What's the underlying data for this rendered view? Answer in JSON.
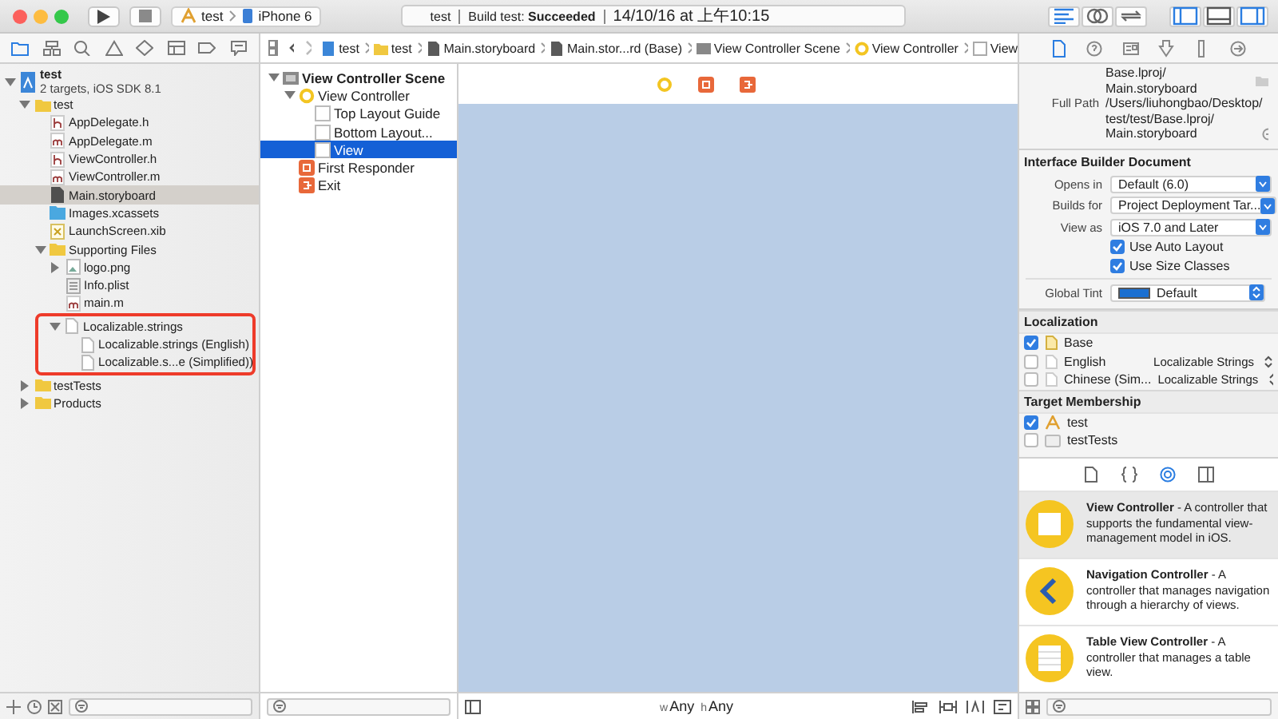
{
  "toolbar": {
    "scheme": "test",
    "device": "iPhone 6",
    "status": {
      "project": "test",
      "build": "Build test: **Succeeded**",
      "time": "14/10/16 at 上午10:15"
    },
    "editor_buttons": [
      {
        "kind": "standard",
        "selected": true
      },
      {
        "kind": "assistant",
        "selected": false
      },
      {
        "kind": "version",
        "selected": false
      }
    ],
    "view_buttons": [
      {
        "kind": "left",
        "selected": true
      },
      {
        "kind": "bottom",
        "selected": false
      },
      {
        "kind": "right",
        "selected": true
      }
    ]
  },
  "navigator_tabs": [
    {
      "kind": "folder",
      "selected": true
    },
    {
      "kind": "hierarchy",
      "selected": false
    },
    {
      "kind": "search",
      "selected": false
    },
    {
      "kind": "warning",
      "selected": false
    },
    {
      "kind": "test",
      "selected": false
    },
    {
      "kind": "debug",
      "selected": false
    },
    {
      "kind": "breakpoint",
      "selected": false
    },
    {
      "kind": "log",
      "selected": false
    }
  ],
  "navigator": [
    {
      "label": "test",
      "subtitle": "2 targets, iOS SDK 8.1",
      "kind": "project",
      "expanded": true,
      "selected": false,
      "highlighted": false,
      "children": [
        {
          "label": "test",
          "kind": "folder",
          "expanded": true,
          "selected": false,
          "highlighted": false,
          "children": [
            {
              "label": "AppDelegate.h",
              "kind": "h",
              "selected": false,
              "highlighted": false
            },
            {
              "label": "AppDelegate.m",
              "kind": "m",
              "selected": false,
              "highlighted": false
            },
            {
              "label": "ViewController.h",
              "kind": "h",
              "selected": false,
              "highlighted": false
            },
            {
              "label": "ViewController.m",
              "kind": "m",
              "selected": false,
              "highlighted": false
            },
            {
              "label": "Main.storyboard",
              "kind": "storyboard",
              "selected": true,
              "highlighted": false
            },
            {
              "label": "Images.xcassets",
              "kind": "assets",
              "selected": false,
              "highlighted": false
            },
            {
              "label": "LaunchScreen.xib",
              "kind": "xib",
              "selected": false,
              "highlighted": false
            },
            {
              "label": "Supporting Files",
              "kind": "folder",
              "expanded": true,
              "selected": false,
              "highlighted": false,
              "children": [
                {
                  "label": "logo.png",
                  "kind": "png",
                  "expanded": false,
                  "selected": false,
                  "highlighted": false
                },
                {
                  "label": "Info.plist",
                  "kind": "plist",
                  "selected": false,
                  "highlighted": false
                },
                {
                  "label": "main.m",
                  "kind": "m",
                  "selected": false,
                  "highlighted": false
                },
                {
                  "label": "Localizable.strings",
                  "kind": "strings",
                  "expanded": true,
                  "selected": false,
                  "highlighted": true,
                  "children": [
                    {
                      "label": "Localizable.strings (English)",
                      "kind": "strings",
                      "selected": false
                    },
                    {
                      "label": "Localizable.s...e (Simplified))",
                      "kind": "strings",
                      "selected": false
                    }
                  ]
                }
              ]
            }
          ]
        },
        {
          "label": "testTests",
          "kind": "folder",
          "expanded": false,
          "selected": false,
          "highlighted": false
        },
        {
          "label": "Products",
          "kind": "folder",
          "expanded": false,
          "selected": false,
          "highlighted": false
        }
      ]
    }
  ],
  "jump_bar": [
    {
      "label": "test",
      "kind": "project"
    },
    {
      "label": "test",
      "kind": "folder"
    },
    {
      "label": "Main.storyboard",
      "kind": "storyboard"
    },
    {
      "label": "Main.stor...rd (Base)",
      "kind": "storyboard"
    },
    {
      "label": "View Controller Scene",
      "kind": "scene"
    },
    {
      "label": "View Controller",
      "kind": "controller"
    },
    {
      "label": "View",
      "kind": "view"
    }
  ],
  "outline": [
    {
      "label": "View Controller Scene",
      "kind": "scene",
      "expanded": true,
      "selected": false,
      "children": [
        {
          "label": "View Controller",
          "kind": "controller",
          "expanded": true,
          "selected": false,
          "children": [
            {
              "label": "Top Layout Guide",
              "kind": "view",
              "selected": false
            },
            {
              "label": "Bottom Layout...",
              "kind": "view",
              "selected": false
            },
            {
              "label": "View",
              "kind": "view",
              "selected": true
            }
          ]
        },
        {
          "label": "First Responder",
          "kind": "responder",
          "selected": false
        },
        {
          "label": "Exit",
          "kind": "exit",
          "selected": false
        }
      ]
    }
  ],
  "canvas": {
    "size_class": [
      {
        "prefix": "w",
        "value": "Any"
      },
      {
        "prefix": "h",
        "value": "Any"
      }
    ]
  },
  "inspector_tabs": [
    {
      "kind": "file",
      "selected": true
    },
    {
      "kind": "help",
      "selected": false
    },
    {
      "kind": "identity",
      "selected": false
    },
    {
      "kind": "attributes",
      "selected": false
    },
    {
      "kind": "size",
      "selected": false
    },
    {
      "kind": "connections",
      "selected": false
    }
  ],
  "inspector": {
    "location_tail": [
      "Base.lproj/",
      "Main.storyboard"
    ],
    "full_path": {
      "label": "Full Path",
      "lines": [
        "/Users/liuhongbao/Desktop/",
        "test/test/Base.lproj/",
        "Main.storyboard"
      ]
    },
    "ib_document": {
      "title": "Interface Builder Document",
      "selects": [
        {
          "label": "Opens in",
          "value": "Default (6.0)"
        },
        {
          "label": "Builds for",
          "value": "Project Deployment Tar..."
        },
        {
          "label": "View as",
          "value": "iOS 7.0 and Later"
        }
      ],
      "checks": [
        {
          "label": "Use Auto Layout",
          "checked": true
        },
        {
          "label": "Use Size Classes",
          "checked": true
        }
      ],
      "tint": {
        "label": "Global Tint",
        "value": "Default"
      }
    },
    "localization": {
      "title": "Localization",
      "items": [
        {
          "label": "Base",
          "checked": true,
          "kind": "base"
        },
        {
          "label": "English",
          "checked": false,
          "kind": "file",
          "value": "Localizable Strings"
        },
        {
          "label": "Chinese (Sim...",
          "checked": false,
          "kind": "file",
          "value": "Localizable Strings"
        }
      ]
    },
    "membership": {
      "title": "Target Membership",
      "items": [
        {
          "label": "test",
          "checked": true,
          "kind": "app"
        },
        {
          "label": "testTests",
          "checked": false,
          "kind": "bundle"
        }
      ]
    }
  },
  "library_tabs": [
    {
      "kind": "file",
      "selected": false
    },
    {
      "kind": "code",
      "selected": false
    },
    {
      "kind": "object",
      "selected": true
    },
    {
      "kind": "media",
      "selected": false
    }
  ],
  "library": [
    {
      "title": "View Controller",
      "description": " - A controller that supports the fundamental view-management model in iOS.",
      "kind": "view",
      "selected": true
    },
    {
      "title": "Navigation Controller",
      "description": " - A controller that manages navigation through a hierarchy of views.",
      "kind": "nav",
      "selected": false
    },
    {
      "title": "Table View Controller",
      "description": " - A controller that manages a table view.",
      "kind": "table",
      "selected": false
    }
  ]
}
